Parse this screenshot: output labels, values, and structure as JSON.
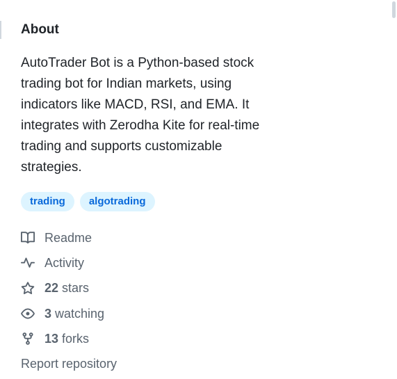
{
  "about": {
    "title": "About",
    "description": "AutoTrader Bot is a Python-based stock trading bot for Indian markets, using indicators like MACD, RSI, and EMA. It integrates with Zerodha Kite for real-time trading and supports customizable strategies.",
    "topics": [
      "trading",
      "algotrading"
    ],
    "meta": {
      "readme": {
        "label": "Readme",
        "icon": "book-icon"
      },
      "activity": {
        "label": "Activity",
        "icon": "pulse-icon"
      },
      "stars": {
        "count": "22",
        "label": "stars",
        "icon": "star-icon"
      },
      "watching": {
        "count": "3",
        "label": "watching",
        "icon": "eye-icon"
      },
      "forks": {
        "count": "13",
        "label": "forks",
        "icon": "repo-forked-icon"
      }
    },
    "report_label": "Report repository"
  },
  "colors": {
    "topic_bg": "#ddf4ff",
    "topic_text": "#0969da",
    "muted_text": "#59636e",
    "primary_text": "#1f2328"
  }
}
